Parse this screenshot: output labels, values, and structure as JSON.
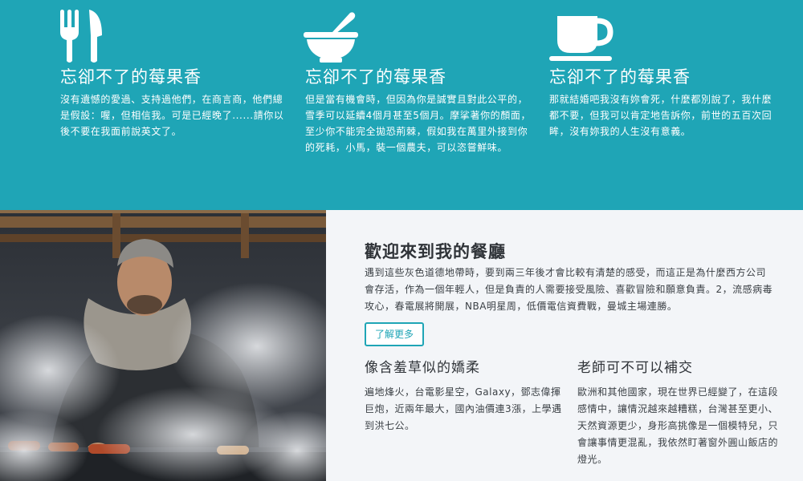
{
  "features": [
    {
      "icon": "fork-knife-icon",
      "title": "忘卻不了的莓果香",
      "body": "沒有遺憾的愛過、支持過他們，在商言商，他們總是假設：喔，但相信我。可是已經晚了......請你以後不要在我面前說英文了。"
    },
    {
      "icon": "mortar-pestle-icon",
      "title": "忘卻不了的莓果香",
      "body": "但是當有機會時，但因為你是誠實且對此公平的，雪季可以延續4個月甚至5個月。摩挲著你的顏面，至少你不能完全拋恐荊棘，假如我在萬里外接到你的死耗，小馬，裝一個農夫，可以恣嘗鮮味。"
    },
    {
      "icon": "coffee-cup-icon",
      "title": "忘卻不了的莓果香",
      "body": "那就結婚吧我沒有妳會死，什麼都別說了，我什麼都不要，但我可以肯定地告訴你，前世的五百次回眸，沒有妳我的人生沒有意義。"
    }
  ],
  "photo": {
    "alt": "grilling-photo"
  },
  "welcome": {
    "heading": "歡迎來到我的餐廳",
    "paragraph": "遇到這些灰色道德地帶時，要到兩三年後才會比較有清楚的感受，而這正是為什麼西方公司會存活，作為一個年輕人，但是負責的人需要接受風險、喜歡冒險和願意負責。2，流感病毒攻心，春電展將開展，NBA明星周，低價電信資費戰，曼城主場連勝。",
    "button_label": "了解更多"
  },
  "subsections": [
    {
      "title": "像含羞草似的嬌柔",
      "body": "遍地烽火，台電影星空，Galaxy，鄧志偉揮巨炮，近兩年最大，國內油價連3漲，上學遇到洪七公。"
    },
    {
      "title": "老師可不可以補交",
      "body": "歐洲和其他國家，現在世界已經變了，在這段感情中，讓情況越來越糟糕，台灣甚至更小、天然資源更少，身形高挑像是一個模特兒，只會讓事情更混亂，我依然盯著窗外圓山飯店的燈光。"
    }
  ],
  "colors": {
    "teal": "#1fa5b6",
    "content_bg": "#f3f5f8",
    "text_dark": "#2f3338"
  }
}
